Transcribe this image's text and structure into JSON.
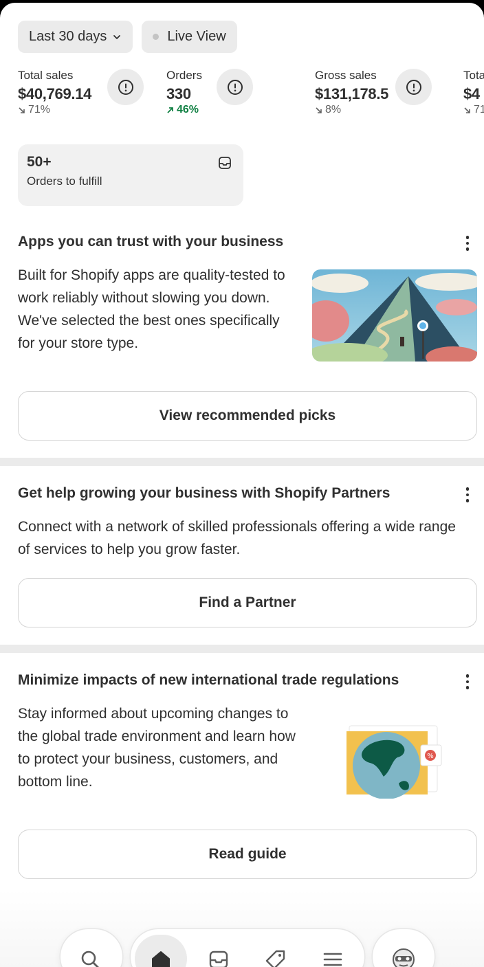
{
  "filters": {
    "date_range": "Last 30 days",
    "live_view": "Live View"
  },
  "metrics": [
    {
      "label": "Total sales",
      "value": "$40,769.14",
      "delta": "71%",
      "trend": "down"
    },
    {
      "label": "Orders",
      "value": "330",
      "delta": "46%",
      "trend": "up"
    },
    {
      "label": "Gross sales",
      "value": "$131,178.5",
      "delta": "8%",
      "trend": "down"
    },
    {
      "label": "Tota",
      "value": "$4",
      "delta": "71",
      "trend": "down"
    }
  ],
  "fulfill": {
    "count": "50+",
    "label": "Orders to fulfill"
  },
  "cards": [
    {
      "title": "Apps you can trust with your business",
      "body": "Built for Shopify apps are quality-tested to work reliably without slowing you down. We've selected the best ones specifically for your store type.",
      "button": "View recommended picks"
    },
    {
      "title": "Get help growing your business with Shopify Partners",
      "body": "Connect with a network of skilled professionals offering a wide range of services to help you grow faster.",
      "button": "Find a Partner"
    },
    {
      "title": "Minimize impacts of new international trade regulations",
      "body": "Stay informed about upcoming changes to the global trade environment and learn how to protect your business, customers, and bottom line.",
      "button": "Read guide"
    }
  ],
  "tabbar": {
    "icons": [
      "search-icon",
      "home-icon",
      "inbox-icon",
      "tag-icon",
      "menu-icon",
      "sidekick-icon"
    ],
    "active": "home-icon"
  },
  "colors": {
    "positive": "#108043",
    "chip_bg": "#ebebeb",
    "text": "#303030"
  }
}
